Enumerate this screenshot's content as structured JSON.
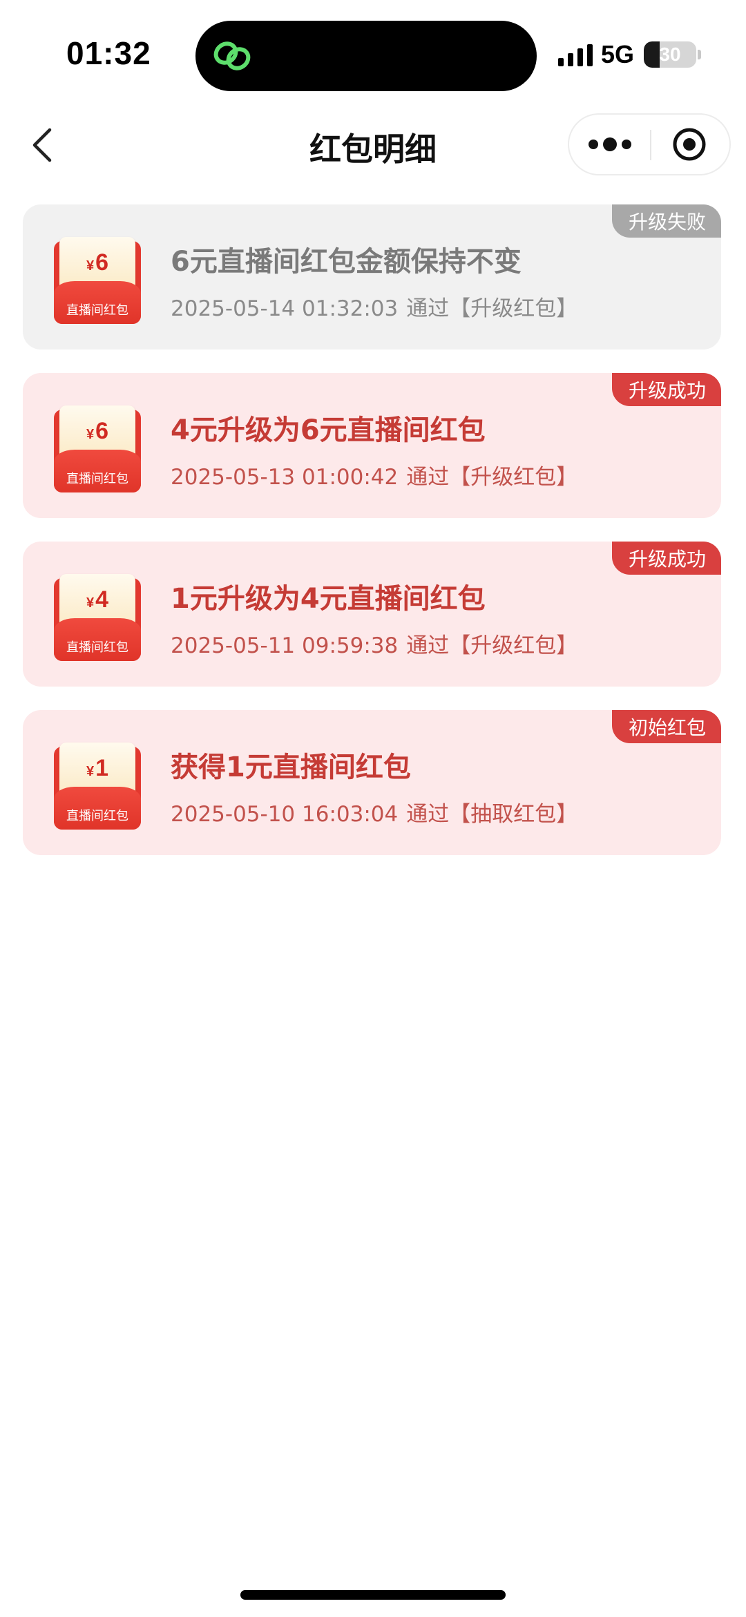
{
  "status_bar": {
    "time": "01:32",
    "network": "5G",
    "battery_level": "30",
    "battery_fraction": 0.3,
    "island_icon": "loop-link-icon",
    "island_icon_color": "#5dde6c"
  },
  "nav": {
    "title": "红包明细",
    "back_icon": "chevron-left-icon",
    "more_icon": "more-dots-icon",
    "close_icon": "target-close-icon"
  },
  "records": [
    {
      "status": "升级失败",
      "state": "fail",
      "amount": "6",
      "currency_symbol": "¥",
      "envelope_label": "直播间红包",
      "title": "6元直播间红包金额保持不变",
      "datetime": "2025-05-14 01:32:03",
      "channel": "通过【升级红包】"
    },
    {
      "status": "升级成功",
      "state": "success",
      "amount": "6",
      "currency_symbol": "¥",
      "envelope_label": "直播间红包",
      "title": "4元升级为6元直播间红包",
      "datetime": "2025-05-13 01:00:42",
      "channel": "通过【升级红包】"
    },
    {
      "status": "升级成功",
      "state": "success",
      "amount": "4",
      "currency_symbol": "¥",
      "envelope_label": "直播间红包",
      "title": "1元升级为4元直播间红包",
      "datetime": "2025-05-11 09:59:38",
      "channel": "通过【升级红包】"
    },
    {
      "status": "初始红包",
      "state": "success",
      "amount": "1",
      "currency_symbol": "¥",
      "envelope_label": "直播间红包",
      "title": "获得1元直播间红包",
      "datetime": "2025-05-10 16:03:04",
      "channel": "通过【抽取红包】"
    }
  ],
  "colors": {
    "success_tag": "#d9403f",
    "fail_tag": "#a8a8a8",
    "success_card": "#fde9ea",
    "fail_card": "#f1f1f1"
  }
}
